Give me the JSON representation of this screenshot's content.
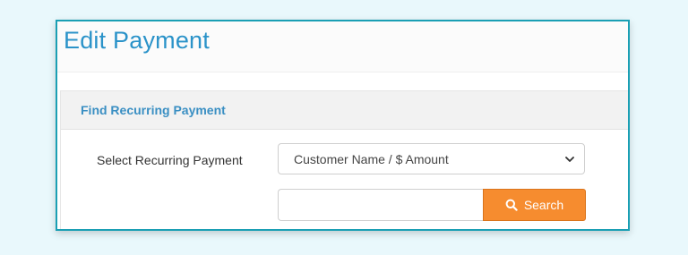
{
  "page": {
    "title": "Edit Payment"
  },
  "section": {
    "heading": "Find Recurring Payment"
  },
  "form": {
    "select_label": "Select Recurring Payment",
    "select_value": "Customer Name / $ Amount",
    "search_value": "",
    "search_button_label": "Search"
  },
  "colors": {
    "title": "#2b93c9",
    "heading": "#3a8fc3",
    "button": "#f68c2f",
    "panel_border": "#1a9fb4"
  },
  "icons": {
    "select_arrow": "chevron-down-icon",
    "search_button": "search-icon"
  }
}
